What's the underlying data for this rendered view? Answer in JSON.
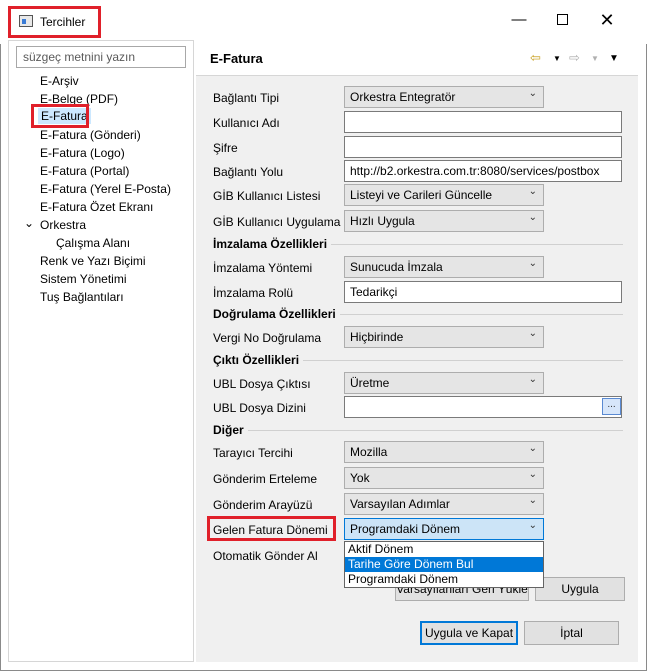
{
  "window": {
    "title": "Tercihler"
  },
  "sidebar": {
    "filter_placeholder": "süzgeç metnini yazın",
    "items": [
      {
        "label": "E-Arşiv"
      },
      {
        "label": "E-Belge (PDF)"
      },
      {
        "label": "E-Fatura"
      },
      {
        "label": "E-Fatura (Gönderi)"
      },
      {
        "label": "E-Fatura (Logo)"
      },
      {
        "label": "E-Fatura (Portal)"
      },
      {
        "label": "E-Fatura (Yerel E-Posta)"
      },
      {
        "label": "E-Fatura Özet Ekranı"
      },
      {
        "label": "Orkestra"
      },
      {
        "label": "Çalışma Alanı"
      },
      {
        "label": "Renk ve Yazı Biçimi"
      },
      {
        "label": "Sistem Yönetimi"
      },
      {
        "label": "Tuş Bağlantıları"
      }
    ]
  },
  "page": {
    "title": "E-Fatura"
  },
  "form": {
    "baglanti_tipi": {
      "label": "Bağlantı Tipi",
      "value": "Orkestra Entegratör"
    },
    "kullanici_adi": {
      "label": "Kullanıcı Adı",
      "value": ""
    },
    "sifre": {
      "label": "Şifre",
      "value": ""
    },
    "baglanti_yolu": {
      "label": "Bağlantı Yolu",
      "value": "http://b2.orkestra.com.tr:8080/services/postbox"
    },
    "gib_listesi": {
      "label": "GİB Kullanıcı Listesi",
      "value": "Listeyi ve Carileri Güncelle"
    },
    "gib_uygulama": {
      "label": "GİB Kullanıcı Uygulama",
      "value": "Hızlı Uygula"
    },
    "imzalama_section": "İmzalama Özellikleri",
    "imzalama_yontemi": {
      "label": "İmzalama Yöntemi",
      "value": "Sunucuda İmzala"
    },
    "imzalama_rolu": {
      "label": "İmzalama Rolü",
      "value": "Tedarikçi"
    },
    "dogrulama_section": "Doğrulama Özellikleri",
    "vergi_no": {
      "label": "Vergi No Doğrulama",
      "value": "Hiçbirinde"
    },
    "cikti_section": "Çıktı Özellikleri",
    "ubl_cikti": {
      "label": "UBL Dosya Çıktısı",
      "value": "Üretme"
    },
    "ubl_dizini": {
      "label": "UBL Dosya Dizini",
      "value": ""
    },
    "diger_section": "Diğer",
    "tarayici": {
      "label": "Tarayıcı Tercihi",
      "value": "Mozilla"
    },
    "gonderim_erteleme": {
      "label": "Gönderim Erteleme",
      "value": "Yok"
    },
    "gonderim_arayuzu": {
      "label": "Gönderim Arayüzü",
      "value": "Varsayılan Adımlar"
    },
    "gelen_fatura": {
      "label": "Gelen Fatura Dönemi",
      "value": "Programdaki Dönem"
    },
    "otomatik_gonder": {
      "label": "Otomatik Gönder Al"
    }
  },
  "dropdown_options": [
    "Aktif Dönem",
    "Tarihe Göre Dönem Bul",
    "Programdaki Dönem"
  ],
  "buttons": {
    "defaults": "Varsayılanları Geri Yükle",
    "apply": "Uygula",
    "apply_close": "Uygula ve Kapat",
    "cancel": "İptal",
    "browse": "..."
  },
  "colors": {
    "highlight": "#e0202a",
    "selection": "#0078d7"
  }
}
